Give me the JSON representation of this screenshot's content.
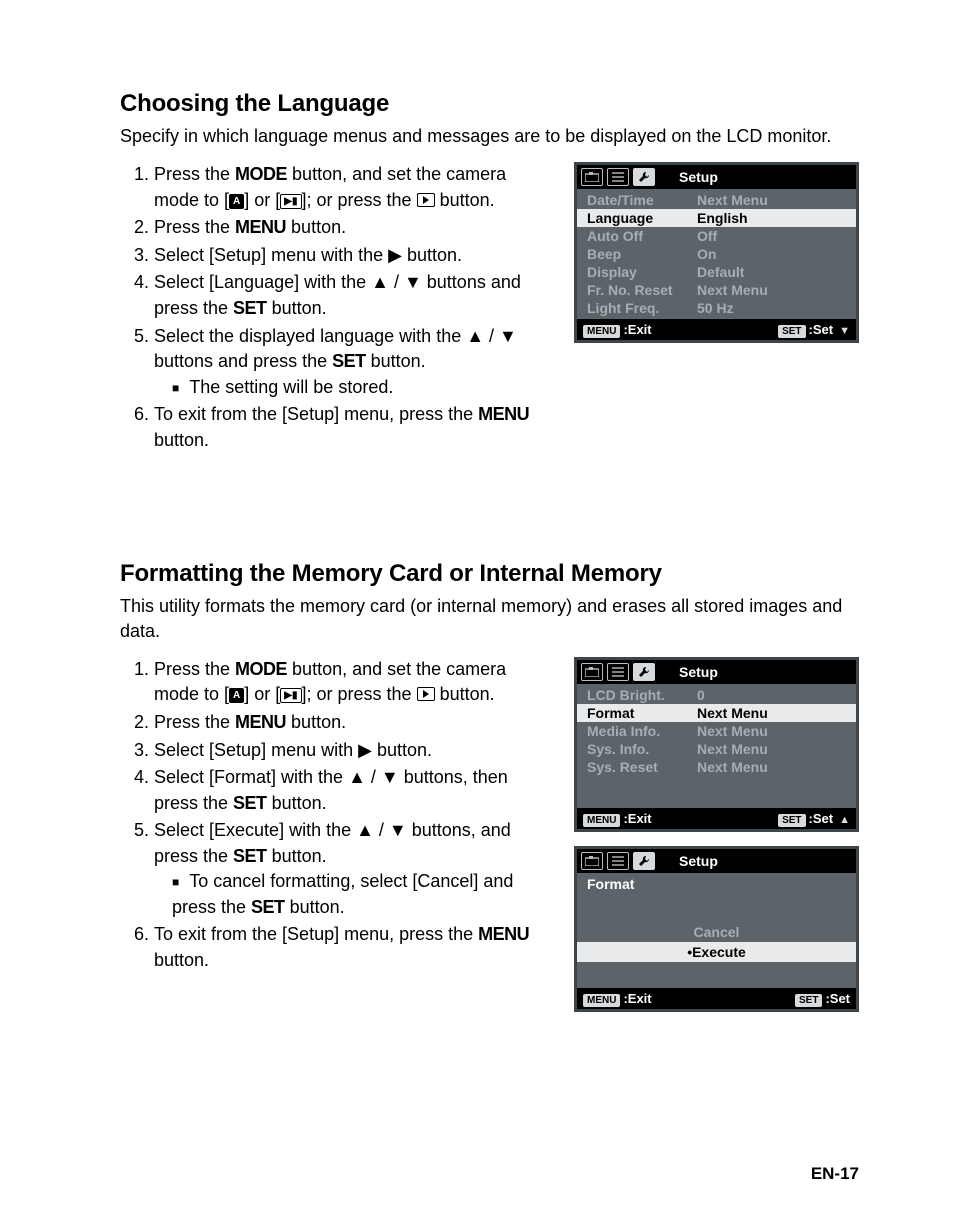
{
  "section1": {
    "heading": "Choosing the Language",
    "intro": "Specify in which language menus and messages are to be displayed on the LCD monitor.",
    "steps": {
      "s1a": "Press the ",
      "s1b": " button, and set the camera mode to [",
      "s1c": "] or [",
      "s1d": "]; or press the ",
      "s1e": " button.",
      "s2a": "Press the ",
      "s2b": " button.",
      "s3": "Select [Setup] menu with the ▶ button.",
      "s4a": "Select [Language] with the ▲ / ▼ buttons and press the ",
      "s4b": " button.",
      "s5a": "Select the displayed language with the ▲ / ▼ buttons and press the ",
      "s5b": " button.",
      "s5sub": "The setting will be stored.",
      "s6a": "To exit from the [Setup] menu, press the ",
      "s6b": " button."
    },
    "labels": {
      "mode": "MODE",
      "menu": "MENU",
      "set": "SET",
      "a": "A",
      "vid": "▶▮"
    }
  },
  "osd1": {
    "title": "Setup",
    "rows": [
      {
        "lab": "Date/Time",
        "val": "Next Menu",
        "sel": false
      },
      {
        "lab": "Language",
        "val": "English",
        "sel": true
      },
      {
        "lab": "Auto Off",
        "val": "Off",
        "sel": false
      },
      {
        "lab": "Beep",
        "val": "On",
        "sel": false
      },
      {
        "lab": "Display",
        "val": "Default",
        "sel": false
      },
      {
        "lab": "Fr. No. Reset",
        "val": "Next Menu",
        "sel": false
      },
      {
        "lab": "Light Freq.",
        "val": "50 Hz",
        "sel": false
      }
    ],
    "foot": {
      "menu": "MENU",
      "exit": ":Exit",
      "set": "SET",
      "setlbl": ":Set",
      "arrow": "▼"
    }
  },
  "section2": {
    "heading": "Formatting the Memory Card or Internal Memory",
    "intro": "This utility formats the memory card (or internal memory) and erases all stored images and data.",
    "steps": {
      "s1a": "Press the ",
      "s1b": " button, and set the camera mode to [",
      "s1c": "] or [",
      "s1d": "]; or press the ",
      "s1e": " button.",
      "s2a": "Press the ",
      "s2b": " button.",
      "s3": "Select [Setup] menu with ▶ button.",
      "s4a": "Select [Format] with the ▲ / ▼ buttons, then press the ",
      "s4b": " button.",
      "s5a": "Select [Execute] with the ▲ / ▼ buttons, and press the ",
      "s5b": " button.",
      "s5sub_a": "To cancel formatting, select [Cancel] and press the ",
      "s5sub_b": " button.",
      "s6a": "To exit from the [Setup] menu, press the ",
      "s6b": " button."
    }
  },
  "osd2": {
    "title": "Setup",
    "rows": [
      {
        "lab": "LCD Bright.",
        "val": "0",
        "sel": false
      },
      {
        "lab": "Format",
        "val": "Next Menu",
        "sel": true
      },
      {
        "lab": "Media Info.",
        "val": "Next Menu",
        "sel": false
      },
      {
        "lab": "Sys. Info.",
        "val": "Next Menu",
        "sel": false
      },
      {
        "lab": "Sys. Reset",
        "val": "Next Menu",
        "sel": false
      }
    ],
    "foot_arrow": "▲"
  },
  "osd3": {
    "title": "Setup",
    "subtitle": "Format",
    "cancel": "Cancel",
    "execute": "•Execute"
  },
  "page_number": "EN-17"
}
